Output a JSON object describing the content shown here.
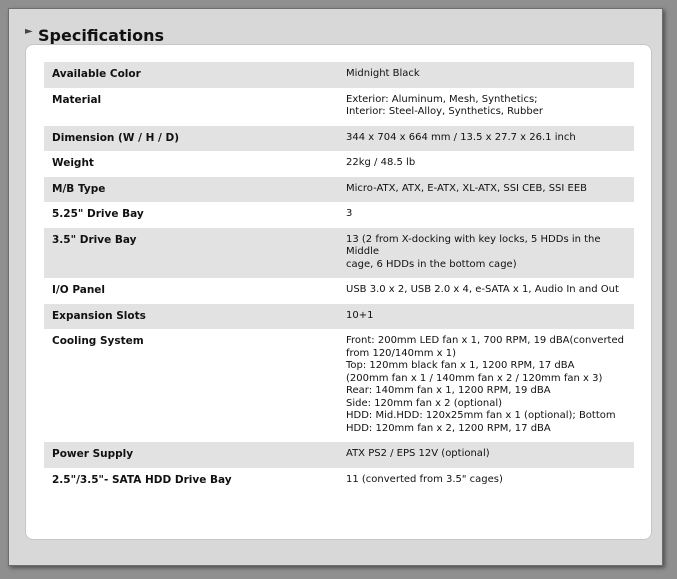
{
  "section": {
    "title": "Specifications"
  },
  "specs": [
    {
      "label": "Available Color",
      "value": "Midnight Black"
    },
    {
      "label": "Material",
      "value": "Exterior: Aluminum, Mesh, Synthetics;\nInterior: Steel-Alloy, Synthetics, Rubber"
    },
    {
      "label": "Dimension (W / H / D)",
      "value": "344 x 704 x 664 mm / 13.5 x 27.7 x 26.1 inch"
    },
    {
      "label": "Weight",
      "value": "22kg / 48.5 lb"
    },
    {
      "label": "M/B Type",
      "value": "Micro-ATX, ATX, E-ATX, XL-ATX, SSI CEB, SSI EEB"
    },
    {
      "label": "5.25\" Drive Bay",
      "value": "3"
    },
    {
      "label": "3.5\" Drive Bay",
      "value": "13 (2 from X-docking with key locks, 5 HDDs in the Middle\ncage, 6 HDDs in the bottom cage)"
    },
    {
      "label": "I/O Panel",
      "value": "USB 3.0 x 2, USB 2.0 x 4, e-SATA x 1, Audio In and Out"
    },
    {
      "label": "Expansion Slots",
      "value": "10+1"
    },
    {
      "label": "Cooling System",
      "value": "Front: 200mm LED fan x 1, 700 RPM, 19 dBA(converted\nfrom 120/140mm x 1)\nTop: 120mm black fan x 1, 1200 RPM, 17 dBA\n(200mm fan x 1 / 140mm fan x 2 / 120mm fan x 3)\nRear: 140mm fan x 1, 1200 RPM, 19 dBA\nSide: 120mm fan x 2 (optional)\nHDD: Mid.HDD: 120x25mm fan x 1 (optional); Bottom\nHDD: 120mm fan x 2, 1200 RPM, 17 dBA"
    },
    {
      "label": "Power Supply",
      "value": "ATX PS2 / EPS 12V (optional)"
    },
    {
      "label": "2.5\"/3.5\"- SATA HDD Drive Bay",
      "value": "11 (converted from 3.5\" cages)"
    }
  ]
}
